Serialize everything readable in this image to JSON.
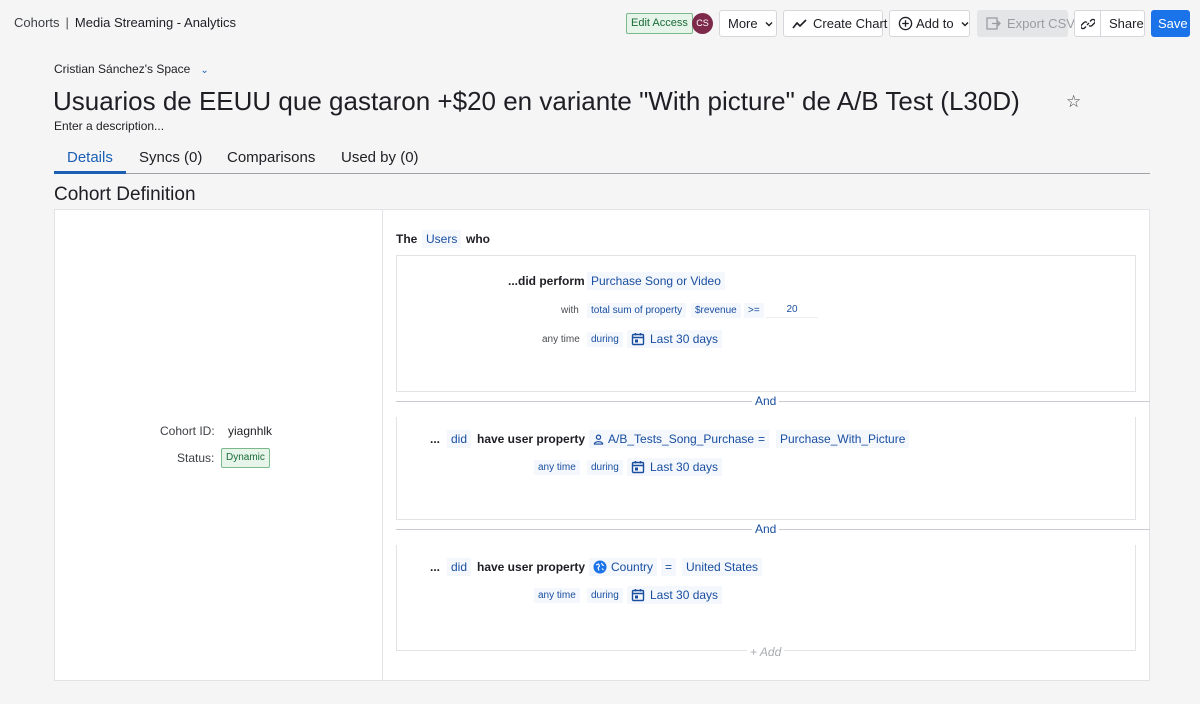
{
  "breadcrumb": {
    "root": "Cohorts",
    "separator": "|",
    "current": "Media Streaming - Analytics"
  },
  "header": {
    "edit_access": "Edit Access",
    "avatar_initials": "CS",
    "more": "More",
    "create_chart": "Create Chart",
    "add_to": "Add to",
    "export_csv": "Export CSV",
    "share": "Share",
    "save": "Save"
  },
  "space": {
    "name": "Cristian Sánchez's Space"
  },
  "cohort": {
    "title": "Usuarios de EEUU que gastaron +$20 en variante \"With picture\" de A/B Test (L30D)",
    "description_placeholder": "Enter a description..."
  },
  "tabs": [
    {
      "label": "Details",
      "active": true
    },
    {
      "label": "Syncs (0)"
    },
    {
      "label": "Comparisons"
    },
    {
      "label": "Used by (0)"
    }
  ],
  "section_title": "Cohort Definition",
  "meta": {
    "id_label": "Cohort ID:",
    "id_value": "yiagnhlk",
    "status_label": "Status:",
    "status_value": "Dynamic"
  },
  "definition": {
    "intro": {
      "the": "The",
      "entity": "Users",
      "who": "who"
    },
    "condition1": {
      "did_perform": "...did perform",
      "event": "Purchase Song or Video",
      "with": "with",
      "aggregate": "total sum of property",
      "property": "$revenue",
      "operator": ">=",
      "value": "20",
      "any_time": "any time",
      "during": "during",
      "range": "Last 30 days"
    },
    "and_label": "And",
    "condition2": {
      "ellipsis": "...",
      "did": "did",
      "have_prop": "have user property",
      "property": "A/B_Tests_Song_Purchase",
      "operator": "=",
      "value": "Purchase_With_Picture",
      "any_time": "any time",
      "during": "during",
      "range": "Last 30 days"
    },
    "condition3": {
      "ellipsis": "...",
      "did": "did",
      "have_prop": "have user property",
      "property": "Country",
      "operator": "=",
      "value": "United States",
      "any_time": "any time",
      "during": "during",
      "range": "Last 30 days"
    },
    "add_label": "+ Add"
  },
  "colors": {
    "accent": "#1a73e8",
    "link": "#1a4fa0",
    "badge_green": "#1a6b37"
  }
}
